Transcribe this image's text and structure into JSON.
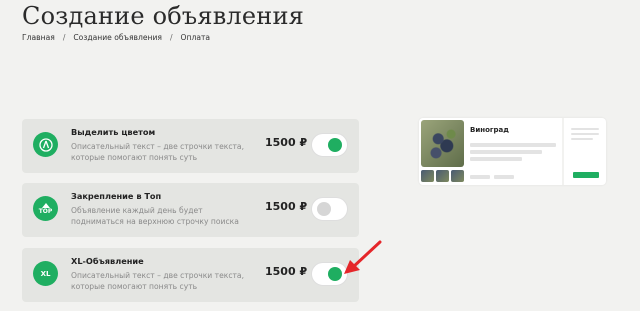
{
  "page": {
    "title": "Создание объявления",
    "breadcrumb": [
      "Главная",
      "Создание объявления",
      "Оплата"
    ],
    "breadcrumb_separator": "/"
  },
  "options": [
    {
      "title": "Выделить цветом",
      "description": "Описательный текст – две строчки текста, которые помогают понять суть",
      "price": "1500 ₽",
      "enabled": true,
      "icon": "palette-icon",
      "icon_text": ""
    },
    {
      "title": "Закрепление в Топ",
      "description": "Объявление каждый день будет подниматься на верхнюю строчку поиска",
      "price": "1500 ₽",
      "enabled": false,
      "icon": "top-icon",
      "icon_text": "TOP"
    },
    {
      "title": "XL-Объявление",
      "description": "Описательный текст – две строчки текста, которые помогают понять суть",
      "price": "1500 ₽",
      "enabled": true,
      "icon": "xl-icon",
      "icon_text": "XL"
    }
  ],
  "preview": {
    "title": "Виноград"
  },
  "colors": {
    "accent": "#1fae61",
    "card_bg": "#e4e5e2",
    "page_bg": "#f2f2f0",
    "arrow": "#e5262a"
  }
}
